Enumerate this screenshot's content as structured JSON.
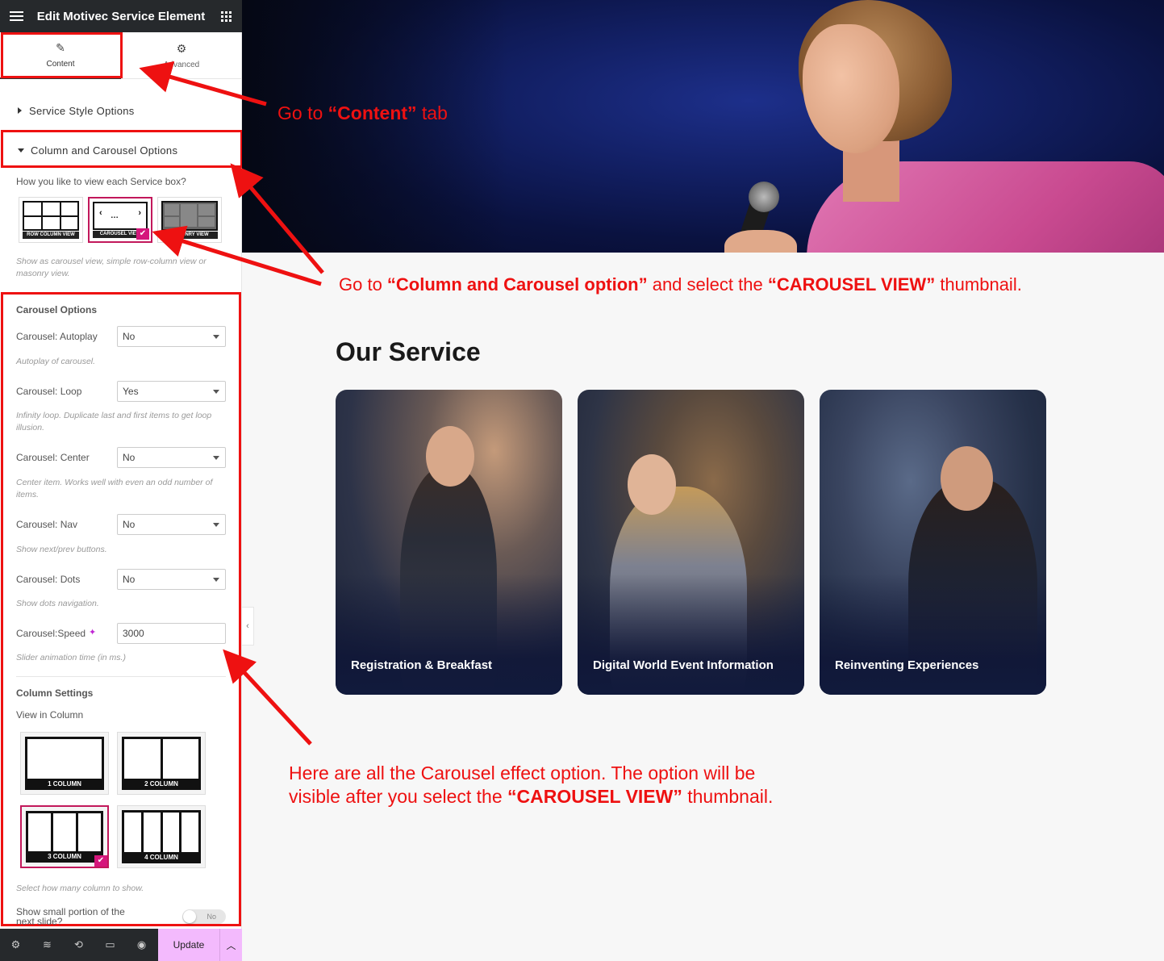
{
  "sidebar": {
    "title": "Edit Motivec Service Element",
    "tabs": [
      {
        "label": "Content",
        "icon": "pencil-icon"
      },
      {
        "label": "Advanced",
        "icon": "gear-icon"
      }
    ],
    "sections": {
      "service_style": "Service Style Options",
      "column_carousel": "Column and Carousel Options"
    },
    "view_question": "How you like to view each Service box?",
    "view_options": [
      "ROW COLUMN VIEW",
      "CAROUSEL VIEW",
      "MASONRY VIEW"
    ],
    "view_help": "Show as carousel view, simple row-column view or masonry view.",
    "carousel_options_heading": "Carousel Options",
    "fields": {
      "autoplay": {
        "label": "Carousel: Autoplay",
        "value": "No",
        "help": "Autoplay of carousel."
      },
      "loop": {
        "label": "Carousel: Loop",
        "value": "Yes",
        "help": "Infinity loop. Duplicate last and first items to get loop illusion."
      },
      "center": {
        "label": "Carousel: Center",
        "value": "No",
        "help": "Center item. Works well with even an odd number of items."
      },
      "nav": {
        "label": "Carousel: Nav",
        "value": "No",
        "help": "Show next/prev buttons."
      },
      "dots": {
        "label": "Carousel: Dots",
        "value": "No",
        "help": "Show dots navigation."
      },
      "speed": {
        "label": "Carousel:Speed",
        "value": "3000",
        "help": "Slider animation time (in ms.)"
      }
    },
    "column_settings_heading": "Column Settings",
    "view_in_column": "View in Column",
    "column_options": [
      "1 COLUMN",
      "2 COLUMN",
      "3 COLUMN",
      "4 COLUMN"
    ],
    "column_help": "Select how many column to show.",
    "small_portion_label": "Show small portion of the next slide?",
    "small_portion_value": "No",
    "footer": {
      "update_label": "Update",
      "icons": [
        "settings-icon",
        "layers-icon",
        "history-icon",
        "responsive-icon",
        "preview-icon"
      ]
    }
  },
  "canvas": {
    "section_title": "Our Service",
    "cards": [
      {
        "title": "Registration & Breakfast"
      },
      {
        "title": "Digital World Event Information"
      },
      {
        "title": "Reinventing Experiences"
      }
    ]
  },
  "annotations": {
    "a1_pre": "Go  to ",
    "a1_bold": "“Content”",
    "a1_post": " tab",
    "a2_pre": "Go to ",
    "a2_bold1": "“Column and Carousel option”",
    "a2_mid": " and select the ",
    "a2_bold2": "“CAROUSEL VIEW”",
    "a2_post": " thumbnail.",
    "a3_line1": "Here are all the Carousel effect option. The option will be",
    "a3_pre": "visible after you select the ",
    "a3_bold": "“CAROUSEL VIEW”",
    "a3_post": " thumbnail."
  },
  "colors": {
    "annotation_red": "#ee1111",
    "accent_pink": "#d5177c",
    "update_button": "#f3bafd",
    "header_dark": "#26292c"
  }
}
